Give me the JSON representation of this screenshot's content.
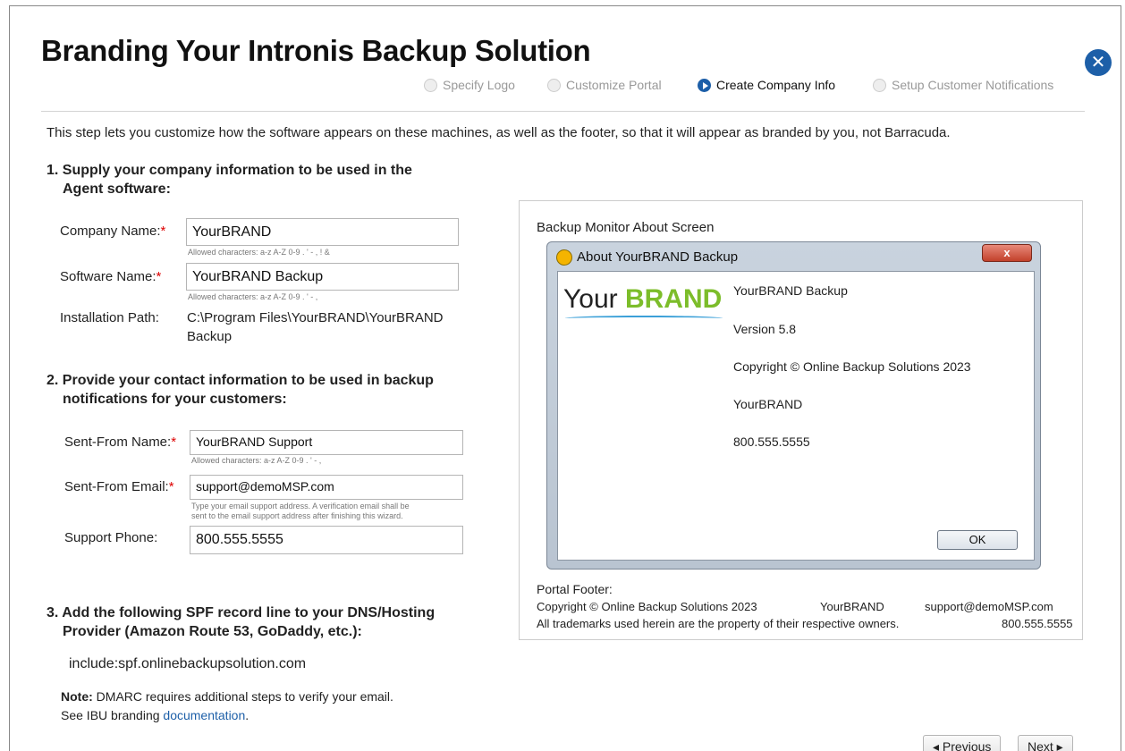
{
  "page": {
    "title": "Branding Your Intronis Backup Solution",
    "intro": "This step lets you customize how the software appears on these machines, as well as the footer, so that it will appear as branded by you, not Barracuda."
  },
  "steps": [
    {
      "label": "Specify Logo",
      "active": false
    },
    {
      "label": "Customize Portal",
      "active": false
    },
    {
      "label": "Create Company Info",
      "active": true
    },
    {
      "label": "Setup Customer Notifications",
      "active": false
    }
  ],
  "section1": {
    "heading_line1": "1. Supply your company information to be used in the",
    "heading_line2": "Agent software:",
    "company_name": {
      "label": "Company Name:",
      "value": "YourBRAND",
      "hint": "Allowed characters: a-z A-Z 0-9 . ' - , ! &"
    },
    "software_name": {
      "label": "Software Name:",
      "value": "YourBRAND Backup",
      "hint": "Allowed characters: a-z A-Z 0-9 . ' - ,"
    },
    "install_path": {
      "label": "Installation Path:",
      "line1": "C:\\Program Files\\YourBRAND\\YourBRAND",
      "line2": "Backup"
    }
  },
  "section2": {
    "heading_line1": "2. Provide your contact information to be used in backup",
    "heading_line2": "notifications for your customers:",
    "sent_from_name": {
      "label": "Sent-From Name:",
      "value": "YourBRAND Support",
      "hint": "Allowed characters: a-z A-Z 0-9 . ' - ,"
    },
    "sent_from_email": {
      "label": "Sent-From Email:",
      "value": "support@demoMSP.com",
      "hint_line1": "Type your email support address. A verification email shall be",
      "hint_line2": "sent to the email support address after finishing this wizard."
    },
    "support_phone": {
      "label": "Support Phone:",
      "value": "800.555.5555"
    }
  },
  "section3": {
    "heading_line1": "3. Add the following SPF record line to your DNS/Hosting",
    "heading_line2": "Provider (Amazon Route 53, GoDaddy, etc.):",
    "spf": "include:spf.onlinebackupsolution.com",
    "note_bold": "Note:",
    "note_text": " DMARC requires additional steps to verify your email.",
    "note_line2": "See IBU branding ",
    "note_link": "documentation",
    "note_end": "."
  },
  "preview": {
    "label": "Backup Monitor About Screen",
    "dialog_title": "About YourBRAND Backup",
    "close_label": "x",
    "logo_your": "Your ",
    "logo_brand": "BRAND",
    "lines": [
      "YourBRAND Backup",
      "Version 5.8",
      "Copyright © Online Backup Solutions 2023",
      "YourBRAND",
      "800.555.5555"
    ],
    "ok_label": "OK"
  },
  "footer": {
    "label": "Portal Footer:",
    "copyright": "Copyright © Online Backup Solutions 2023",
    "brand": "YourBRAND",
    "email": "support@demoMSP.com",
    "trademark": "All trademarks used herein are the property of their respective owners.",
    "phone": "800.555.5555"
  },
  "nav": {
    "previous": "◂ Previous",
    "next": "Next ▸"
  },
  "close_glyph": "✕"
}
